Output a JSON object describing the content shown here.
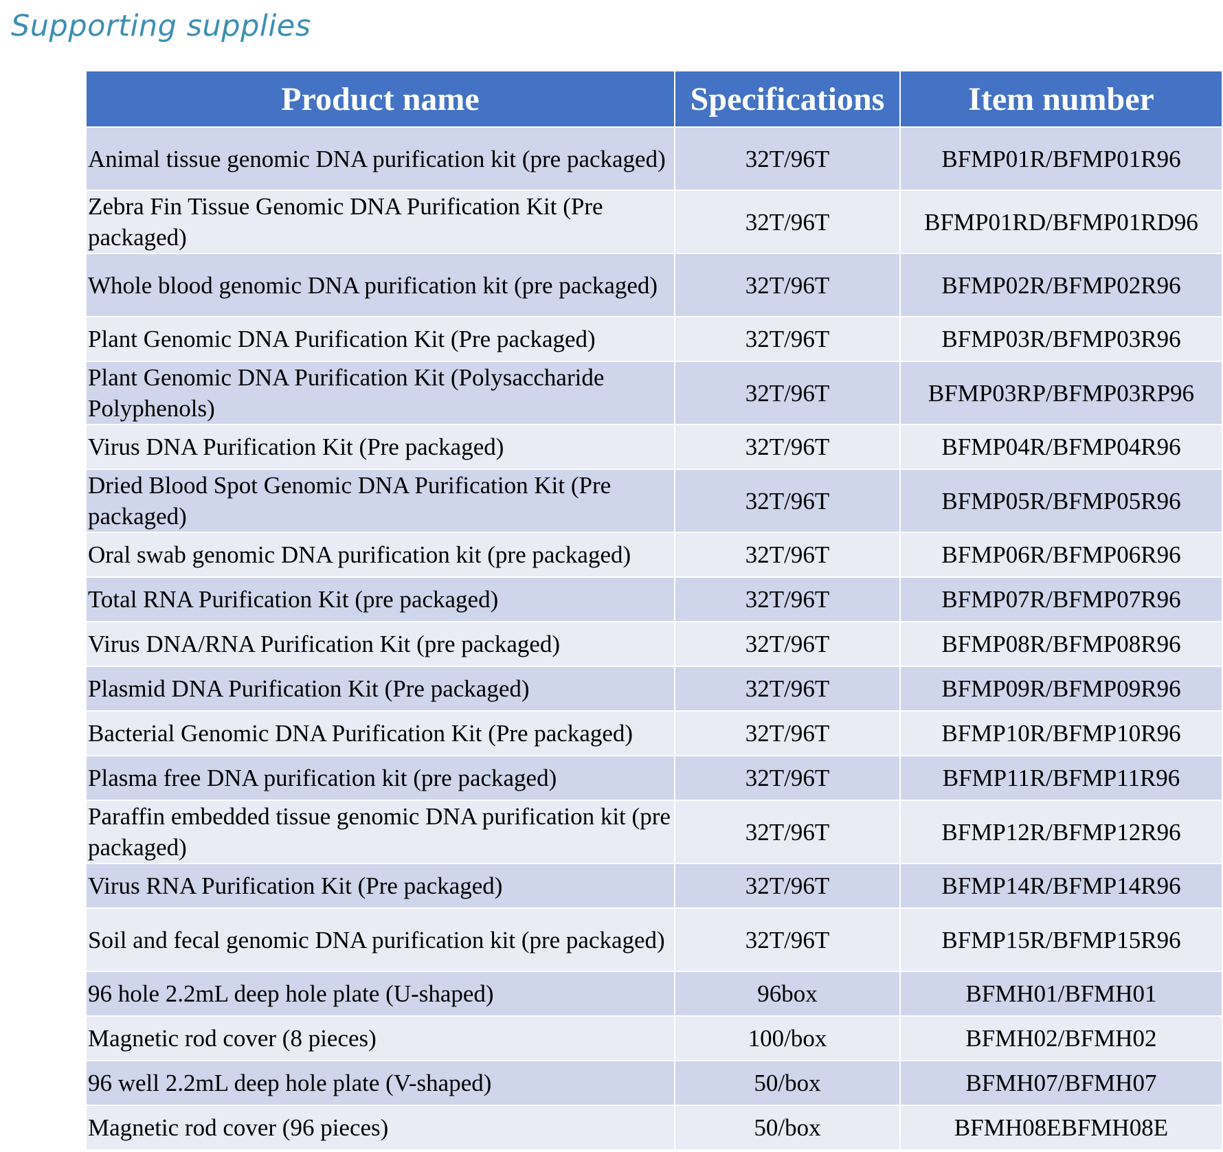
{
  "page": {
    "title": "Supporting supplies"
  },
  "table": {
    "headers": {
      "product_name": "Product name",
      "specifications": "Specifications",
      "item_number": "Item number"
    },
    "rows": [
      {
        "name": "Animal tissue genomic DNA purification kit (pre packaged)",
        "spec": "32T/96T",
        "item": "BFMP01R/BFMP01R96"
      },
      {
        "name": "Zebra Fin Tissue Genomic DNA Purification Kit (Pre packaged)",
        "spec": "32T/96T",
        "item": "BFMP01RD/BFMP01RD96"
      },
      {
        "name": "Whole blood genomic DNA purification kit (pre packaged)",
        "spec": "32T/96T",
        "item": "BFMP02R/BFMP02R96"
      },
      {
        "name": "Plant Genomic DNA Purification Kit (Pre packaged)",
        "spec": "32T/96T",
        "item": "BFMP03R/BFMP03R96"
      },
      {
        "name": "Plant Genomic DNA Purification Kit (Polysaccharide Polyphenols)",
        "spec": "32T/96T",
        "item": "BFMP03RP/BFMP03RP96"
      },
      {
        "name": "Virus DNA Purification Kit (Pre packaged)",
        "spec": "32T/96T",
        "item": "BFMP04R/BFMP04R96"
      },
      {
        "name": "Dried Blood Spot Genomic DNA Purification Kit (Pre packaged)",
        "spec": "32T/96T",
        "item": "BFMP05R/BFMP05R96"
      },
      {
        "name": "Oral swab genomic DNA purification kit (pre packaged)",
        "spec": "32T/96T",
        "item": "BFMP06R/BFMP06R96"
      },
      {
        "name": "Total RNA Purification Kit (pre packaged)",
        "spec": "32T/96T",
        "item": "BFMP07R/BFMP07R96"
      },
      {
        "name": "Virus DNA/RNA Purification Kit (pre packaged)",
        "spec": "32T/96T",
        "item": "BFMP08R/BFMP08R96"
      },
      {
        "name": "Plasmid DNA Purification Kit (Pre packaged)",
        "spec": "32T/96T",
        "item": "BFMP09R/BFMP09R96"
      },
      {
        "name": "Bacterial Genomic DNA Purification Kit (Pre packaged)",
        "spec": "32T/96T",
        "item": "BFMP10R/BFMP10R96"
      },
      {
        "name": "Plasma free DNA purification kit (pre packaged)",
        "spec": "32T/96T",
        "item": "BFMP11R/BFMP11R96"
      },
      {
        "name": "Paraffin embedded tissue genomic DNA purification kit (pre packaged)",
        "spec": "32T/96T",
        "item": "BFMP12R/BFMP12R96"
      },
      {
        "name": "Virus RNA Purification Kit (Pre packaged)",
        "spec": "32T/96T",
        "item": "BFMP14R/BFMP14R96"
      },
      {
        "name": "Soil and fecal genomic DNA purification kit (pre packaged)",
        "spec": "32T/96T",
        "item": "BFMP15R/BFMP15R96"
      },
      {
        "name": "96 hole 2.2mL deep hole plate (U-shaped)",
        "spec": "96box",
        "item": "BFMH01/BFMH01"
      },
      {
        "name": "Magnetic rod cover (8 pieces)",
        "spec": "100/box",
        "item": "BFMH02/BFMH02"
      },
      {
        "name": "96 well 2.2mL deep hole plate (V-shaped)",
        "spec": "50/box",
        "item": "BFMH07/BFMH07"
      },
      {
        "name": "Magnetic rod cover (96 pieces)",
        "spec": "50/box",
        "item": "BFMH08EBFMH08E"
      }
    ]
  },
  "colors": {
    "header_bg": "#4472c4",
    "row_odd_bg": "#cfd5ea",
    "row_even_bg": "#e9ebf5",
    "title_color": "#3b8fb3"
  }
}
